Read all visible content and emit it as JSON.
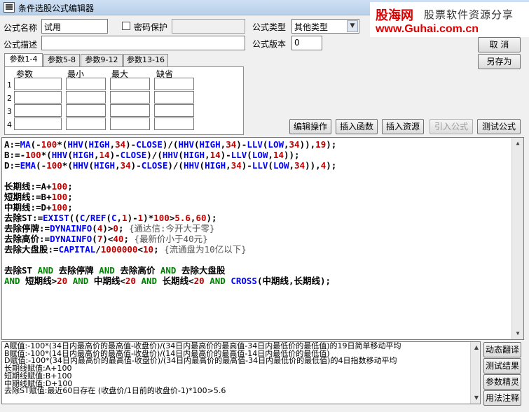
{
  "window": {
    "title": "条件选股公式编辑器"
  },
  "watermark": {
    "brand": "股海网",
    "slogan": "股票软件资源分享",
    "url": "www.Guhai.com.cn"
  },
  "form": {
    "name_label": "公式名称",
    "name_value": "试用",
    "password_label": "密码保护",
    "type_label": "公式类型",
    "type_value": "其他类型",
    "desc_label": "公式描述",
    "desc_value": "",
    "version_label": "公式版本",
    "version_value": "0"
  },
  "buttons": {
    "cancel": "取 消",
    "save_as": "另存为",
    "edit_ops": "编辑操作",
    "insert_func": "插入函数",
    "insert_res": "插入资源",
    "import_formula": "引入公式",
    "test_formula": "测试公式",
    "dynamic_translate": "动态翻译",
    "test_result": "测试结果",
    "param_tips": "参数精灵",
    "usage_notes": "用法注释"
  },
  "tabs": [
    "参数1-4",
    "参数5-8",
    "参数9-12",
    "参数13-16"
  ],
  "params": {
    "headers": [
      "参数",
      "最小",
      "最大",
      "缺省"
    ],
    "rows": [
      "1",
      "2",
      "3",
      "4"
    ]
  },
  "code_lines": [
    "A:=MA(-100*(HHV(HIGH,34)-CLOSE)/(HHV(HIGH,34)-LLV(LOW,34)),19);",
    "B:=-100*(HHV(HIGH,14)-CLOSE)/(HHV(HIGH,14)-LLV(LOW,14));",
    "D:=EMA(-100*(HHV(HIGH,34)-CLOSE)/(HHV(HIGH,34)-LLV(LOW,34)),4);",
    "",
    "长期线:=A+100;",
    "短期线:=B+100;",
    "中期线:=D+100;",
    "去除ST:=EXIST((C/REF(C,1)-1)*100>5.6,60);",
    "去除停牌:=DYNAINFO(4)>0; {通达信:今开大于零}",
    "去除高价:=DYNAINFO(7)<40; {最新价小于40元}",
    "去除大盘股:=CAPITAL/1000000<10; {流通盘为10亿以下}",
    "",
    "去除ST AND 去除停牌 AND 去除高价 AND 去除大盘股",
    "AND 短期线>20 AND 中期线<20 AND 长期线<20 AND CROSS(中期线,长期线);"
  ],
  "output_lines": [
    "A赋值:-100*(34日内最高价的最高值-收盘价)/(34日内最高价的最高值-34日内最低价的最低值)的19日简单移动平均",
    "B赋值:-100*(14日内最高价的最高值-收盘价)/(14日内最高价的最高值-14日内最低价的最低值)",
    "D赋值:-100*(34日内最高价的最高值-收盘价)/(34日内最高价的最高值-34日内最低价的最低值)的4日指数移动平均",
    "长期线赋值:A+100",
    "短期线赋值:B+100",
    "中期线赋值:D+100",
    "去除ST赋值:最近60日存在 (收盘价/1日前的收盘价-1)*100>5.6"
  ]
}
